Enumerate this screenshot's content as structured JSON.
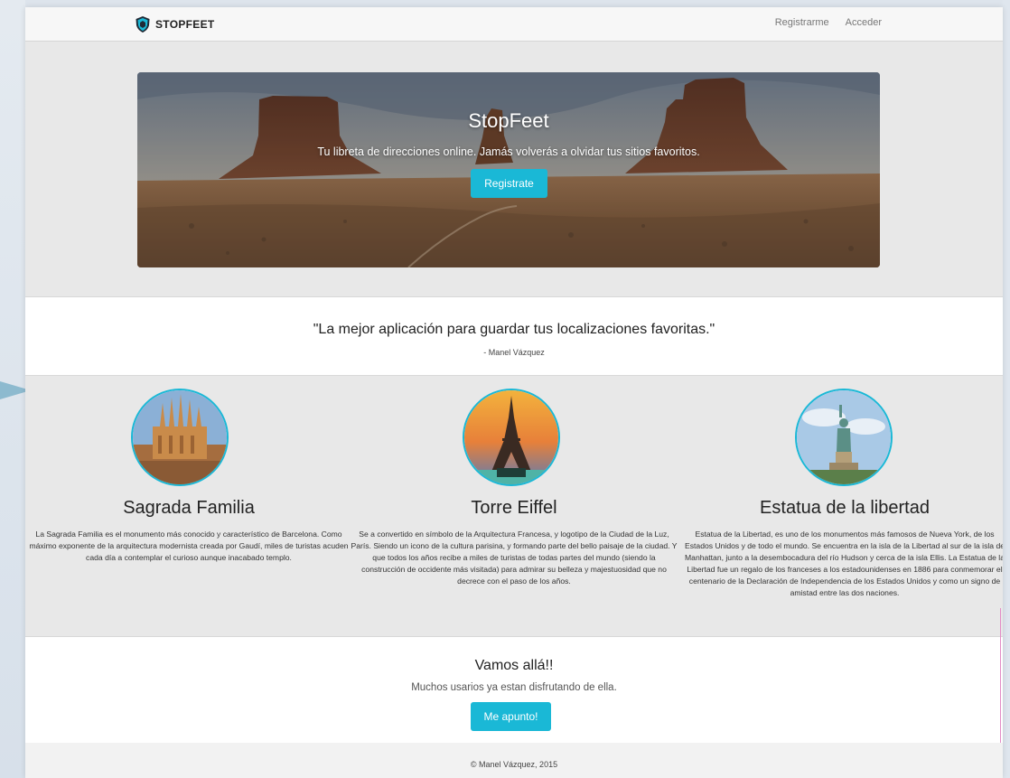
{
  "navbar": {
    "brand": "STOPFEET",
    "links": [
      "Registrarme",
      "Acceder"
    ]
  },
  "hero": {
    "title": "StopFeet",
    "subtitle": "Tu libreta de direcciones online. Jamás volverás a olvidar tus sitios favoritos.",
    "button": "Registrate"
  },
  "quote": {
    "text": "\"La mejor aplicación para guardar tus localizaciones favoritas.\"",
    "author": "- Manel Vázquez"
  },
  "features": [
    {
      "title": "Sagrada Familia",
      "description": "La Sagrada Familia es el monumento más conocido y característico de Barcelona. Como máximo exponente de la arquitectura modernista creada por Gaudí, miles de turistas acuden cada día a contemplar el curioso aunque inacabado templo."
    },
    {
      "title": "Torre Eiffel",
      "description": "Se a convertido en símbolo de la Arquitectura Francesa, y logotipo de la Ciudad de la Luz, París. Siendo un icono de la cultura parisina, y formando parte del bello paisaje de la ciudad. Y que todos los años recibe a miles de turistas de todas partes del mundo (siendo la construcción de occidente más visitada) para admirar su belleza y majestuosidad que no decrece con el paso de los años."
    },
    {
      "title": "Estatua de la libertad",
      "description": "Estatua de la Libertad, es uno de los monumentos más famosos de Nueva York, de los Estados Unidos y de todo el mundo. Se encuentra en la isla de la Libertad al sur de la isla de Manhattan, junto a la desembocadura del río Hudson y cerca de la isla Ellis. La Estatua de la Libertad fue un regalo de los franceses a los estadounidenses en 1886 para conmemorar el centenario de la Declaración de Independencia de los Estados Unidos y como un signo de amistad entre las dos naciones."
    }
  ],
  "cta": {
    "title": "Vamos allá!!",
    "subtitle": "Muchos usarios ya estan disfrutando de ella.",
    "button": "Me apunto!"
  },
  "footer": {
    "text": "© Manel Vázquez, 2015"
  },
  "colors": {
    "accent": "#1ab8d6",
    "page_bg": "#e8e8e8",
    "navbar_bg": "#f7f7f7"
  },
  "icons": {
    "brand": "shield-logo-icon"
  }
}
